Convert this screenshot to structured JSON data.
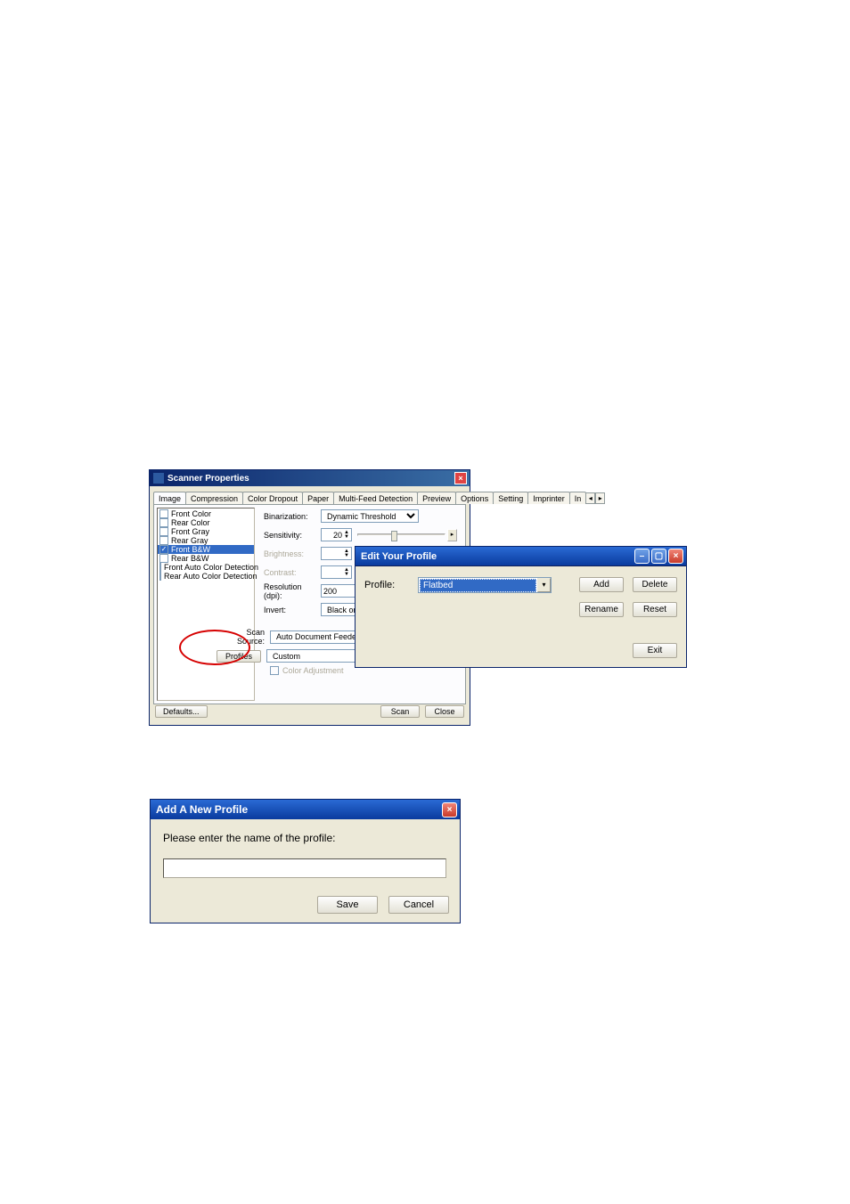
{
  "scanner": {
    "title": "Scanner Properties",
    "tabs": [
      "Image",
      "Compression",
      "Color Dropout",
      "Paper",
      "Multi-Feed Detection",
      "Preview",
      "Options",
      "Setting",
      "Imprinter",
      "In"
    ],
    "img_types": [
      {
        "label": "Front Color",
        "checked": false
      },
      {
        "label": "Rear Color",
        "checked": false
      },
      {
        "label": "Front Gray",
        "checked": false
      },
      {
        "label": "Rear Gray",
        "checked": false
      },
      {
        "label": "Front B&W",
        "checked": true,
        "selected": true
      },
      {
        "label": "Rear B&W",
        "checked": false
      },
      {
        "label": "Front Auto Color Detection",
        "checked": false
      },
      {
        "label": "Rear Auto Color Detection",
        "checked": false
      }
    ],
    "binarization_label": "Binarization:",
    "binarization_value": "Dynamic Threshold",
    "sensitivity_label": "Sensitivity:",
    "sensitivity_value": "20",
    "brightness_label": "Brightness:",
    "contrast_label": "Contrast:",
    "resolution_label": "Resolution (dpi):",
    "resolution_value": "200",
    "invert_label": "Invert:",
    "invert_value": "Black on White",
    "scan_source_label": "Scan Source:",
    "scan_source_value": "Auto Document Feeder",
    "profiles_label": "Profiles",
    "profiles_value": "Custom",
    "color_adj": "Color Adjustment",
    "defaults": "Defaults...",
    "scan": "Scan",
    "close": "Close"
  },
  "edit": {
    "title": "Edit Your Profile",
    "profile_label": "Profile:",
    "profile_value": "Flatbed",
    "add": "Add",
    "delete": "Delete",
    "rename": "Rename",
    "reset": "Reset",
    "exit": "Exit"
  },
  "add": {
    "title": "Add A New Profile",
    "prompt": "Please enter the name of the profile:",
    "value": "",
    "save": "Save",
    "cancel": "Cancel"
  }
}
